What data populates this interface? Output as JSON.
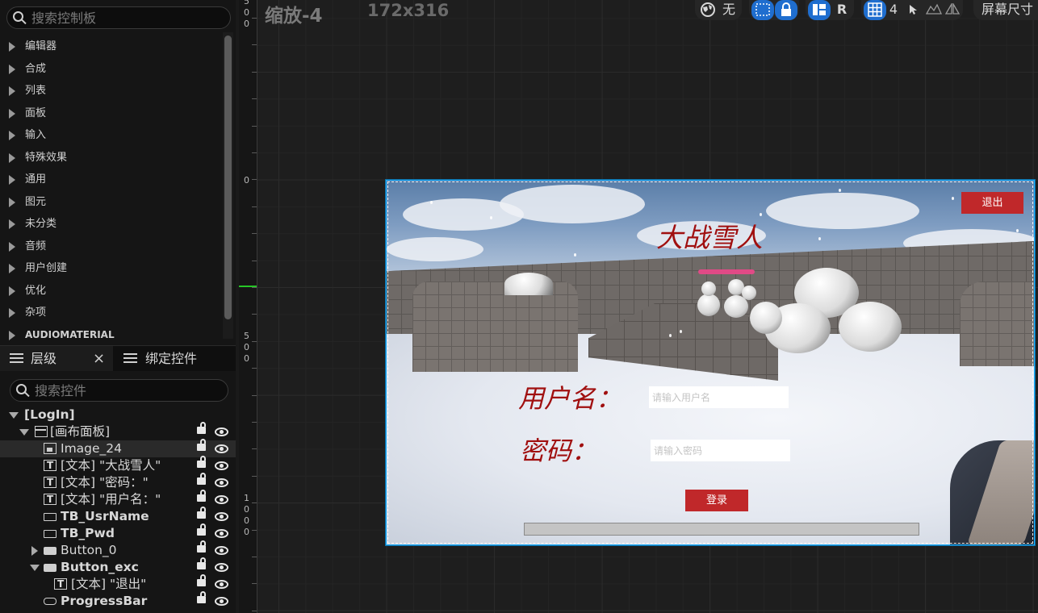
{
  "palette": {
    "search_placeholder": "搜索控制板",
    "categories": [
      "编辑器",
      "合成",
      "列表",
      "面板",
      "输入",
      "特殊效果",
      "通用",
      "图元",
      "未分类",
      "音频",
      "用户创建",
      "优化",
      "杂项",
      "AUDIOMATERIAL"
    ]
  },
  "hierarchy_tabs": {
    "level_tab": "层级",
    "close": "×",
    "binding_tab": "绑定控件"
  },
  "hierarchy": {
    "search_placeholder": "搜索控件",
    "rows": [
      {
        "label": "[LogIn]"
      },
      {
        "label": "[画布面板]"
      },
      {
        "label": "Image_24"
      },
      {
        "label": "[文本] \"大战雪人\""
      },
      {
        "label": "[文本] \"密码：\""
      },
      {
        "label": "[文本] \"用户名：\""
      },
      {
        "label": "TB_UsrName"
      },
      {
        "label": "TB_Pwd"
      },
      {
        "label": "Button_0"
      },
      {
        "label": "Button_exc"
      },
      {
        "label": "[文本] \"退出\""
      },
      {
        "label": "ProgressBar"
      }
    ]
  },
  "designer": {
    "zoom": "缩放-4",
    "size": "172x316",
    "toolbar": {
      "space_none": "无",
      "r_label": "R",
      "grid_count": "4",
      "screen_size": "屏幕尺寸"
    },
    "ruler_labels": [
      "5",
      "0",
      "0",
      "0",
      "5",
      "0",
      "0",
      "1",
      "0",
      "0",
      "0"
    ]
  },
  "game": {
    "title": "大战雪人",
    "exit_label": "退出",
    "username_label": "用户名：",
    "password_label": "密码：",
    "username_placeholder": "请输入用户名",
    "password_placeholder": "请输入密码",
    "login_label": "登录",
    "progress": 0,
    "accent_red": "#c0282a",
    "title_red": "#a00f0f"
  },
  "icons": {
    "palette_search": "search-icon",
    "hierarchy_search": "search-icon",
    "globe": "globe-icon",
    "marquee": "marquee-icon",
    "lock": "lock-icon",
    "grid": "grid-icon",
    "cursor": "cursor-icon"
  }
}
